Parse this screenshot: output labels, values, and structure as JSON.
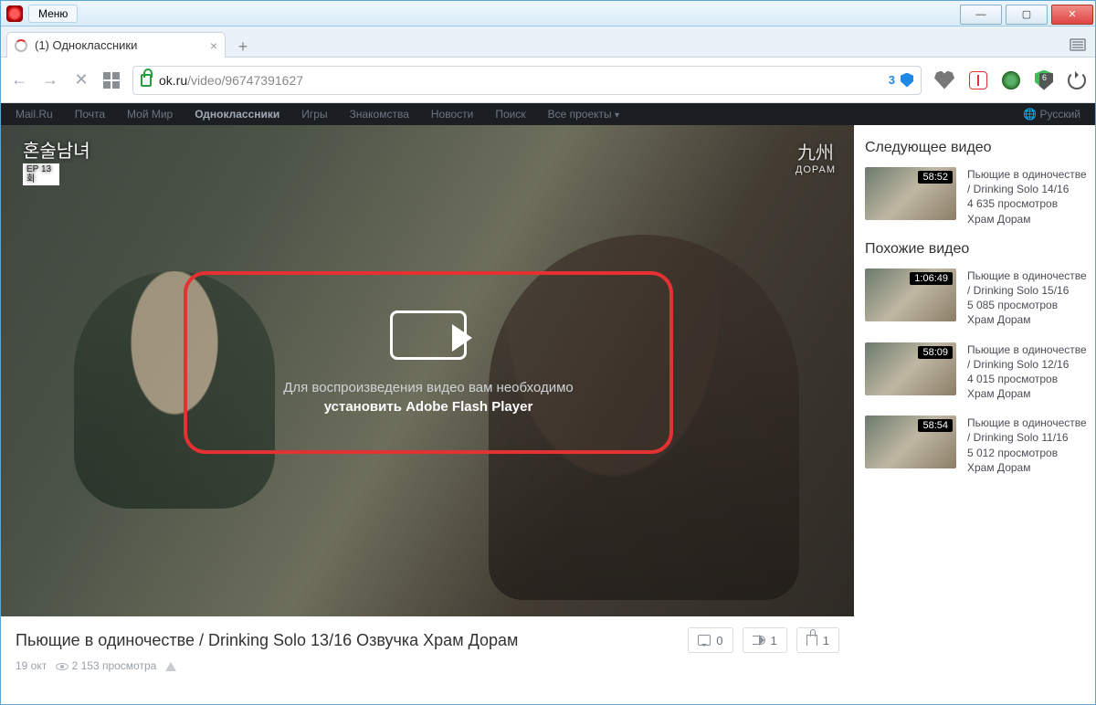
{
  "browser": {
    "menu_label": "Меню",
    "tab_title": "(1) Одноклассники",
    "url_host": "ok.ru",
    "url_path": "/video/96747391627",
    "security_badge": "3",
    "ext_shield_badge": "6"
  },
  "topbar": {
    "items": [
      "Mail.Ru",
      "Почта",
      "Мой Мир",
      "Одноклассники",
      "Игры",
      "Знакомства",
      "Новости",
      "Поиск",
      "Все проекты"
    ],
    "active_index": 3,
    "right": "Русский"
  },
  "player": {
    "logo_tl": "혼술남녀",
    "logo_tl_ep": "EP 13회",
    "logo_tr_main": "九州",
    "logo_tr_sub": "ДОРАМ",
    "overlay_line1": "Для воспроизведения видео вам необходимо",
    "overlay_line2": "установить Adobe Flash Player"
  },
  "video": {
    "title": "Пьющие в одиночестве / Drinking Solo 13/16 Озвучка Храм Дорам",
    "comments": "0",
    "shares": "1",
    "likes": "1",
    "date": "19 окт",
    "views": "2 153 просмотра"
  },
  "sidebar": {
    "heading_next": "Следующее видео",
    "heading_similar": "Похожие видео",
    "next": {
      "duration": "58:52",
      "line1": "Пьющие в одиночестве",
      "line2": "/ Drinking Solo 14/16",
      "line3": "4 635 просмотров",
      "line4": "Храм Дорам"
    },
    "similar": [
      {
        "duration": "1:06:49",
        "line1": "Пьющие в одиночестве",
        "line2": "/ Drinking Solo 15/16",
        "line3": "5 085 просмотров",
        "line4": "Храм Дорам"
      },
      {
        "duration": "58:09",
        "line1": "Пьющие в одиночестве",
        "line2": "/ Drinking Solo 12/16",
        "line3": "4 015 просмотров",
        "line4": "Храм Дорам"
      },
      {
        "duration": "58:54",
        "line1": "Пьющие в одиночестве",
        "line2": "/ Drinking Solo 11/16",
        "line3": "5 012 просмотров",
        "line4": "Храм Дорам"
      }
    ]
  }
}
